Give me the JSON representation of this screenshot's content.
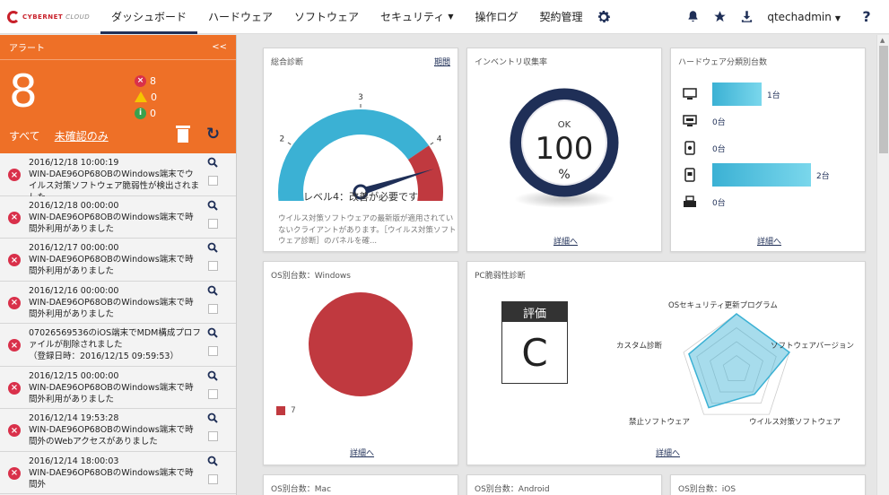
{
  "nav": {
    "logo": "CYBERNET",
    "logo_sub": "CLOUD",
    "items": [
      "ダッシュボード",
      "ハードウェア",
      "ソフトウェア",
      "セキュリティ",
      "操作ログ",
      "契約管理"
    ],
    "user": "qtechadmin",
    "help": "?"
  },
  "alert": {
    "title": "アラート",
    "collapse": "<<",
    "total": "8",
    "error_count": "8",
    "warning_count": "0",
    "info_count": "0",
    "filter_all": "すべて",
    "filter_unread": "未確認のみ",
    "items": [
      {
        "date": "2016/12/18 10:00:19",
        "text": "WIN-DAE96OP68OBのWindows端末でウイルス対策ソフトウェア脆弱性が検出されました"
      },
      {
        "date": "2016/12/18 00:00:00",
        "text": "WIN-DAE96OP68OBのWindows端末で時間外利用がありました"
      },
      {
        "date": "2016/12/17 00:00:00",
        "text": "WIN-DAE96OP68OBのWindows端末で時間外利用がありました"
      },
      {
        "date": "2016/12/16 00:00:00",
        "text": "WIN-DAE96OP68OBのWindows端末で時間外利用がありました"
      },
      {
        "date": "07026569536のiOS端末でMDM構成プロファイルが削除されました",
        "text": "（登録日時：2016/12/15 09:59:53）"
      },
      {
        "date": "2016/12/15 00:00:00",
        "text": "WIN-DAE96OP68OBのWindows端末で時間外利用がありました"
      },
      {
        "date": "2016/12/14 19:53:28",
        "text": "WIN-DAE96OP68OBのWindows端末で時間外のWebアクセスがありました"
      },
      {
        "date": "2016/12/14 18:00:03",
        "text": "WIN-DAE96OP68OBのWindows端末で時間外"
      }
    ]
  },
  "panels": {
    "overall": {
      "title": "総合診断",
      "link": "期間",
      "level_text": "レベル4：改善が必要です",
      "desc": "ウイルス対策ソフトウェアの最新版が適用されていないクライアントがあります。［ウイルス対策ソフトウェア診断］のパネルを確...",
      "detail": "詳細へ",
      "gauge_value": 4.3,
      "ticks": [
        "1",
        "2",
        "3",
        "4",
        "5"
      ]
    },
    "inventory": {
      "title": "インベントリ収集率",
      "status": "OK",
      "value": "100",
      "unit": "%",
      "detail": "詳細へ"
    },
    "hardware": {
      "title": "ハードウェア分類別台数",
      "items": [
        {
          "icon": "desktop-icon",
          "label": "1台",
          "count": 1
        },
        {
          "icon": "mac-icon",
          "label": "0台",
          "count": 0
        },
        {
          "icon": "android-icon",
          "label": "0台",
          "count": 0
        },
        {
          "icon": "ios-icon",
          "label": "2台",
          "count": 2
        },
        {
          "icon": "printer-icon",
          "label": "0台",
          "count": 0
        }
      ],
      "detail": "詳細へ"
    },
    "os_windows": {
      "title": "OS別台数：Windows",
      "legend_value": "7",
      "detail": "詳細へ"
    },
    "pc_vuln": {
      "title": "PC脆弱性診断",
      "grade_label": "評価",
      "grade": "C",
      "axes": [
        "OSセキュリティ更新プログラム",
        "ソフトウェアバージョン",
        "ウイルス対策ソフトウェア",
        "禁止ソフトウェア",
        "カスタム診断"
      ],
      "detail": "詳細へ"
    },
    "os_mac": {
      "title": "OS別台数：Mac"
    },
    "os_android": {
      "title": "OS別台数：Android"
    },
    "os_ios": {
      "title": "OS別台数：iOS"
    }
  },
  "colors": {
    "accent_orange": "#ee7027",
    "navy": "#1f2f57",
    "error_red": "#d9304a",
    "gauge_blue": "#3bb1d4",
    "gauge_red": "#c0393f"
  }
}
